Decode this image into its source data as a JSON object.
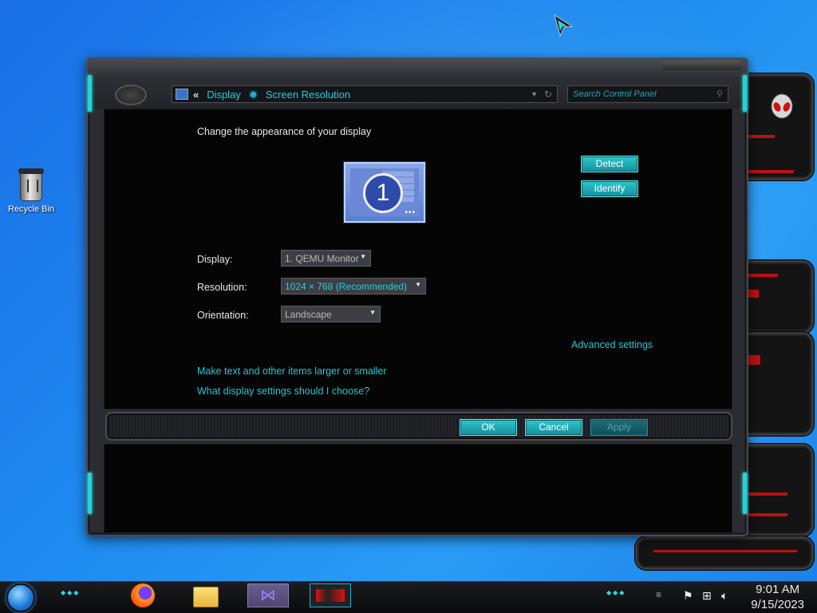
{
  "desktop": {
    "icons": [
      {
        "label": "Recycle Bin",
        "icon": "recycle-bin-icon"
      }
    ]
  },
  "window": {
    "breadcrumb": [
      "Display",
      "Screen Resolution"
    ],
    "search_placeholder": "Search Control Panel",
    "heading": "Change the appearance of your display",
    "monitor_number": "1",
    "buttons": {
      "detect": "Detect",
      "identify": "Identify",
      "ok": "OK",
      "cancel": "Cancel",
      "apply": "Apply"
    },
    "settings": {
      "display": {
        "label": "Display:",
        "value": "1. QEMU Monitor"
      },
      "resolution": {
        "label": "Resolution:",
        "value": "1024 × 768 (Recommended)"
      },
      "orientation": {
        "label": "Orientation:",
        "value": "Landscape"
      }
    },
    "links": {
      "advanced": "Advanced settings",
      "text_size": "Make text and other items larger or smaller",
      "help": "What display settings should I choose?"
    }
  },
  "taskbar": {
    "apps": [
      "firefox-icon",
      "file-explorer-icon",
      "visual-studio-installer-icon",
      "alienware-control-icon"
    ],
    "tray_icons": [
      "flag-icon",
      "network-icon",
      "volume-icon"
    ],
    "clock": {
      "time": "9:01 AM",
      "date": "9/15/2023"
    }
  },
  "colors": {
    "accent": "#22c6d6",
    "button": "#1fa9b2",
    "widget_red": "#ff2a2a"
  }
}
